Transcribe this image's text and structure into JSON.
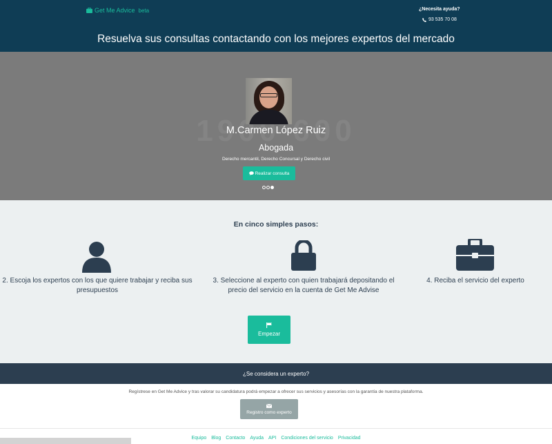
{
  "header": {
    "brand": "Get Me Advice",
    "brand_suffix": "beta",
    "help_label": "¿Necesita ayuda?",
    "phone": "93 535 70 08",
    "headline": "Resuelva sus consultas contactando con los mejores expertos del mercado"
  },
  "hero": {
    "background_text": "1900 600",
    "expert_name": "M.Carmen López Ruiz",
    "expert_role": "Abogada",
    "expert_areas": "Derecho mercantil, Derecho Concursal y Derecho civil",
    "consult_button": "Realizar consulta",
    "carousel_active_index": 2,
    "carousel_count": 3
  },
  "steps": {
    "title": "En cinco simples pasos:",
    "items": [
      {
        "icon": "user-icon",
        "text": "2. Escoja los expertos con los que quiere trabajar y reciba sus presupuestos"
      },
      {
        "icon": "lock-icon",
        "text": "3. Seleccione al experto con quien trabajará depositando el precio del servicio en la cuenta de Get Me Advise"
      },
      {
        "icon": "briefcase-icon",
        "text": "4. Reciba el servicio del experto"
      }
    ],
    "start_button": "Empezar"
  },
  "expert_band": {
    "question": "¿Se considera un experto?"
  },
  "register": {
    "text": "Regístrese en Get Me Advice y tras valorar su candidatura podrá empezar a ofrecer sus servicios y asesorías con la garantía de nuestra plataforma.",
    "button": "Registro como experto"
  },
  "footer": {
    "links": [
      "Equipo",
      "Blog",
      "Contacto",
      "Ayuda",
      "API",
      "Condiciones del servicio",
      "Privacidad"
    ]
  },
  "colors": {
    "header_bg": "#0f3d55",
    "accent": "#1abc9c",
    "dark": "#2c3e50",
    "hero_bg": "#7b7b7b",
    "steps_bg": "#ecf0f1"
  }
}
